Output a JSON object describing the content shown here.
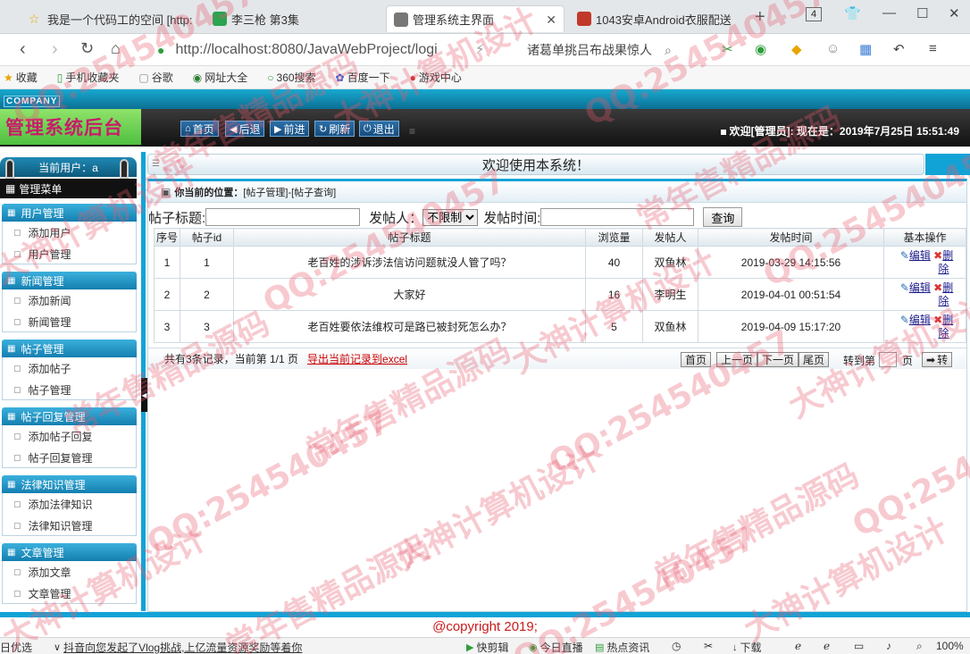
{
  "browser": {
    "tabs": [
      {
        "title": "我是一个代码工的空间 [http:"
      },
      {
        "title": "李三枪 第3集"
      },
      {
        "title": "管理系统主界面"
      },
      {
        "title": "1043安卓Android衣服配送"
      }
    ],
    "tab_count": "4",
    "url": "http://localhost:8080/JavaWebProject/logi",
    "search_text": "诸葛单挑吕布战果惊人",
    "bookmarks": [
      "收藏",
      "手机收藏夹",
      "谷歌",
      "网址大全",
      "360搜索",
      "百度一下",
      "游戏中心"
    ]
  },
  "header": {
    "company": "COMPANY",
    "title": "管理系统后台",
    "buttons": [
      "首页",
      "后退",
      "前进",
      "刷新",
      "退出"
    ],
    "welcome": "欢迎[管理员]: 现在是：2019年7月25日 15:51:49"
  },
  "sidebar": {
    "current_user": "当前用户：a",
    "menu_title": "管理菜单",
    "groups": [
      {
        "title": "用户管理",
        "items": [
          "添加用户",
          "用户管理"
        ]
      },
      {
        "title": "新闻管理",
        "items": [
          "添加新闻",
          "新闻管理"
        ]
      },
      {
        "title": "帖子管理",
        "items": [
          "添加帖子",
          "帖子管理"
        ]
      },
      {
        "title": "帖子回复管理",
        "items": [
          "添加帖子回复",
          "帖子回复管理"
        ]
      },
      {
        "title": "法律知识管理",
        "items": [
          "添加法律知识",
          "法律知识管理"
        ]
      },
      {
        "title": "文章管理",
        "items": [
          "添加文章",
          "文章管理"
        ]
      }
    ]
  },
  "content": {
    "welcome_bar": "欢迎使用本系统！",
    "location_label": "你当前的位置：",
    "location_path": "[帖子管理]-[帖子查询]",
    "search": {
      "title_label": "帖子标题:",
      "poster_label": "发帖人：",
      "poster_selected": "不限制",
      "time_label": "发帖时间:",
      "query_button": "查询"
    },
    "table": {
      "headers": [
        "序号",
        "帖子id",
        "帖子标题",
        "浏览量",
        "发帖人",
        "发帖时间",
        "基本操作"
      ],
      "rows": [
        {
          "no": "1",
          "id": "1",
          "title": "老百姓的涉诉涉法信访问题就没人管了吗？",
          "views": "40",
          "poster": "双鱼林",
          "time": "2019-03-29 14:15:56"
        },
        {
          "no": "2",
          "id": "2",
          "title": "大家好",
          "views": "16",
          "poster": "李明生",
          "time": "2019-04-01 00:51:54"
        },
        {
          "no": "3",
          "id": "3",
          "title": "老百姓要依法维权可是路已被封死怎么办？",
          "views": "5",
          "poster": "双鱼林",
          "time": "2019-04-09 15:17:20"
        }
      ],
      "edit_label": "编辑",
      "delete_label_1": "删",
      "delete_label_2": "除"
    },
    "pager": {
      "info": "共有3条记录，当前第 1/1 页",
      "export": "导出当前记录到excel",
      "first": "首页",
      "prev": "上一页",
      "next": "下一页",
      "last": "尾页",
      "goto_label": "转到第",
      "page_unit": "页",
      "go": "转"
    }
  },
  "footer": {
    "copyright": "@copyright 2019;"
  },
  "statusbar": {
    "left": "日优选",
    "news": "抖音向您发起了Vlog挑战,上亿流量资源奖励等着你",
    "items": [
      "快剪辑",
      "今日直播",
      "热点资讯",
      "下载"
    ],
    "zoom": "100%"
  },
  "watermark": [
    "QQ:254540457",
    "常年售精品源码",
    "大神计算机设计"
  ]
}
